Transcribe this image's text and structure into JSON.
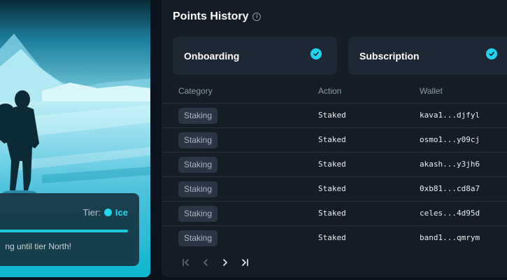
{
  "hero": {
    "tier_label": "Tier:",
    "tier_value": "Ice",
    "message": "ng until tier North!",
    "colors": {
      "accent": "#21d9f2",
      "bar": "#22c6dc"
    }
  },
  "panel": {
    "title": "Points History",
    "cards": [
      {
        "label": "Onboarding",
        "done": true
      },
      {
        "label": "Subscription",
        "done": true
      }
    ],
    "columns": [
      "Category",
      "Action",
      "Wallet"
    ],
    "rows": [
      {
        "category": "Staking",
        "action": "Staked",
        "wallet": "kava1...djfyl"
      },
      {
        "category": "Staking",
        "action": "Staked",
        "wallet": "osmo1...y09cj"
      },
      {
        "category": "Staking",
        "action": "Staked",
        "wallet": "akash...y3jh6"
      },
      {
        "category": "Staking",
        "action": "Staked",
        "wallet": "0xb81...cd8a7"
      },
      {
        "category": "Staking",
        "action": "Staked",
        "wallet": "celes...4d95d"
      },
      {
        "category": "Staking",
        "action": "Staked",
        "wallet": "band1...qmrym"
      }
    ],
    "pagination": {
      "icons": [
        "first-page-icon",
        "prev-page-icon",
        "next-page-icon",
        "last-page-icon"
      ]
    }
  }
}
